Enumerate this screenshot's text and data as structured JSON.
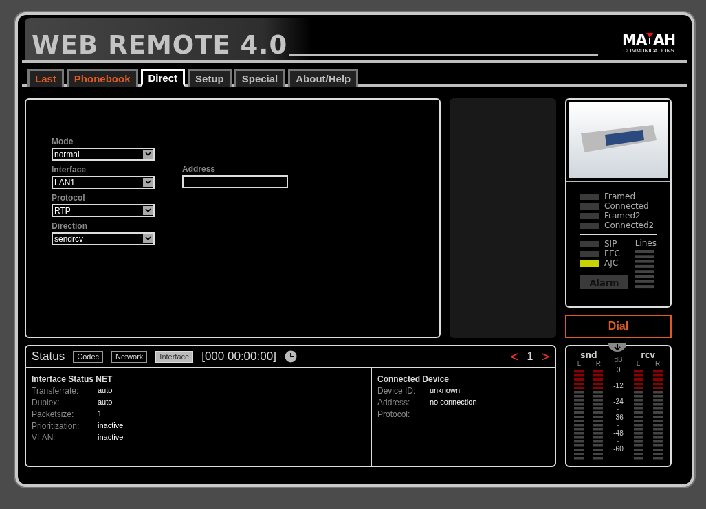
{
  "header": {
    "title": "WEB REMOTE 4.0",
    "logo": {
      "left": "MA",
      "right": "AH",
      "subtitle": "COMMUNICATIONS"
    }
  },
  "tabs": [
    {
      "label": "Last",
      "selected": false,
      "highlighted": true
    },
    {
      "label": "Phonebook",
      "selected": false,
      "highlighted": true
    },
    {
      "label": "Direct",
      "selected": true,
      "highlighted": false
    },
    {
      "label": "Setup",
      "selected": false,
      "highlighted": false
    },
    {
      "label": "Special",
      "selected": false,
      "highlighted": false
    },
    {
      "label": "About/Help",
      "selected": false,
      "highlighted": false
    }
  ],
  "form": {
    "selects": [
      {
        "label": "Mode",
        "value": "normal"
      },
      {
        "label": "Interface",
        "value": "LAN1"
      },
      {
        "label": "Protocol",
        "value": "RTP"
      },
      {
        "label": "Direction",
        "value": "sendrcv"
      }
    ],
    "address": {
      "label": "Address"
    }
  },
  "device": {
    "leds": [
      {
        "label": "Framed",
        "on": false
      },
      {
        "label": "Connected",
        "on": false
      },
      {
        "label": "Framed2",
        "on": false
      },
      {
        "label": "Connected2",
        "on": false
      }
    ],
    "flags": [
      {
        "label": "SIP",
        "on": false
      },
      {
        "label": "FEC",
        "on": false
      },
      {
        "label": "AJC",
        "on": true
      }
    ],
    "alarm": "Alarm",
    "lines_label": "Lines"
  },
  "dial": "Dial",
  "status": {
    "title": "Status",
    "tabs": [
      {
        "label": "Codec",
        "selected": false
      },
      {
        "label": "Network",
        "selected": false
      },
      {
        "label": "Interface",
        "selected": true
      }
    ],
    "time": "[000 00:00:00]",
    "prev": "<",
    "page": "1",
    "next": ">",
    "left": {
      "heading": "Interface Status NET",
      "rows": [
        {
          "label": "Transferrate:",
          "value": "auto"
        },
        {
          "label": "Duplex:",
          "value": "auto"
        },
        {
          "label": "Packetsize:",
          "value": "1"
        },
        {
          "label": "Prioritization:",
          "value": "inactive"
        },
        {
          "label": "VLAN:",
          "value": "inactive"
        }
      ]
    },
    "right": {
      "heading": "Connected Device",
      "rows": [
        {
          "label": "Device ID:",
          "value": "unknown"
        },
        {
          "label": "Address:",
          "value": "no connection"
        },
        {
          "label": "Protocol:",
          "value": ""
        }
      ]
    }
  },
  "meters": {
    "send": "snd",
    "receive": "rcv",
    "unit": "dB",
    "channels": [
      "L",
      "R",
      "L",
      "R"
    ],
    "scale": [
      "0",
      "-12",
      "-24",
      "-36",
      "-48",
      "-60"
    ]
  }
}
